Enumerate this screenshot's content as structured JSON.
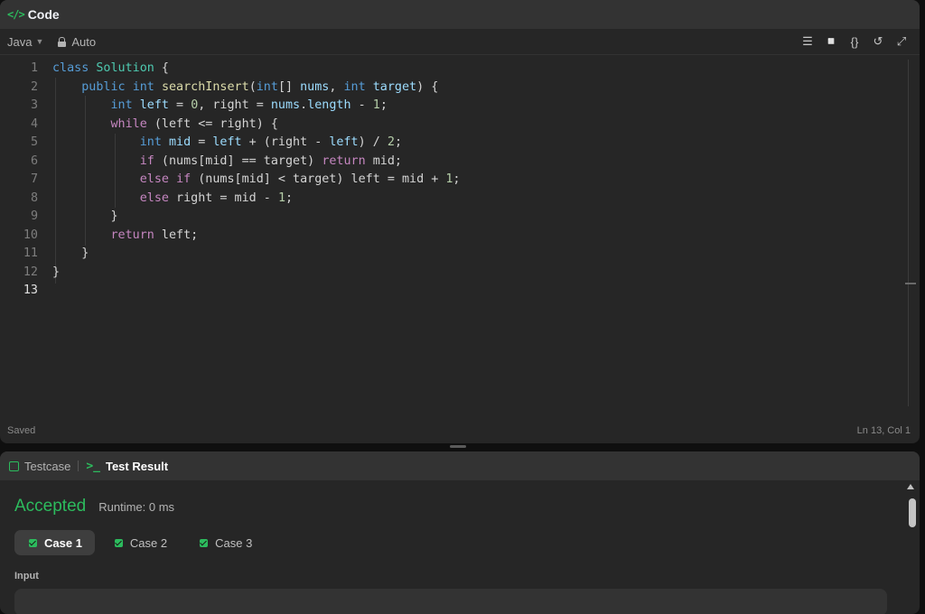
{
  "code_panel": {
    "title": "Code",
    "language": "Java",
    "mode": "Auto",
    "status_left": "Saved",
    "status_right": "Ln 13, Col 1"
  },
  "toolbar_icons": [
    "format-icon",
    "bookmark-icon",
    "braces-icon",
    "reset-icon",
    "expand-icon"
  ],
  "code_lines": [
    "class Solution {",
    "    public int searchInsert(int[] nums, int target) {",
    "        int left = 0, right = nums.length - 1;",
    "        while (left <= right) {",
    "            int mid = left + (right - left) / 2;",
    "            if (nums[mid] == target) return mid;",
    "            else if (nums[mid] < target) left = mid + 1;",
    "            else right = mid - 1;",
    "        }",
    "        return left;",
    "    }",
    "}",
    ""
  ],
  "result_panel": {
    "tab_testcase": "Testcase",
    "tab_result": "Test Result",
    "verdict": "Accepted",
    "runtime": "Runtime: 0 ms",
    "cases": [
      "Case 1",
      "Case 2",
      "Case 3"
    ],
    "selected_case": "Case 1",
    "input_label": "Input"
  },
  "colors": {
    "accent": "#2cbb5d",
    "background": "#262626",
    "header": "#333333"
  }
}
